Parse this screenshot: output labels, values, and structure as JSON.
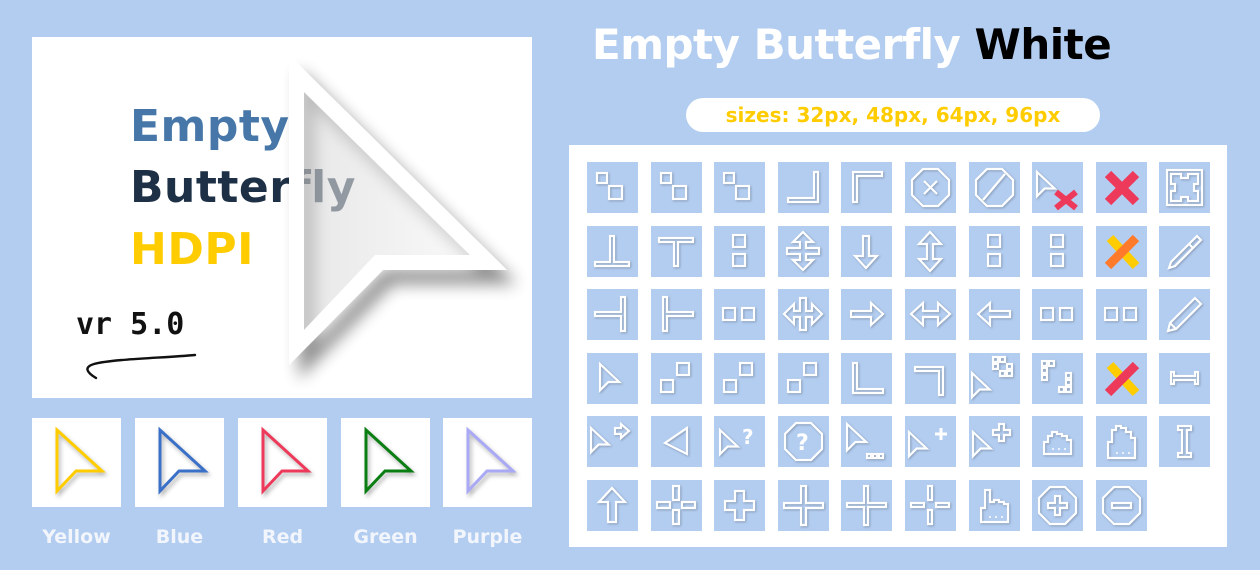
{
  "preview": {
    "title_line1": "Empty",
    "title_line2": "Butterfly",
    "title_line3": "HDPI",
    "version": "vr 5.0",
    "colors": {
      "line1": "#4677A8",
      "line2": "#1E3045",
      "line3": "#FFCC00"
    }
  },
  "variants": [
    {
      "label": "Yellow",
      "color": "#FFCC00"
    },
    {
      "label": "Blue",
      "color": "#3A70C8"
    },
    {
      "label": "Red",
      "color": "#EE3A5A"
    },
    {
      "label": "Green",
      "color": "#0A7E12"
    },
    {
      "label": "Purple",
      "color": "#A9A9F5"
    }
  ],
  "header": {
    "title_main": "Empty Butterfly",
    "title_accent": "White",
    "sizes_label": "sizes: 32px, 48px, 64px, 96px"
  },
  "icon_grid": {
    "rows": [
      [
        "resize-diagonal-1",
        "resize-diagonal-2",
        "resize-diagonal-3",
        "corner-bottom-right",
        "corner-top-left",
        "not-allowed-octagon-x",
        "no-drop",
        "pointer-x",
        "red-x",
        "fullscreen-frame"
      ],
      [
        "side-bottom",
        "side-top",
        "resize-vertical-boxes",
        "split-vertical",
        "arrow-down",
        "resize-vertical",
        "resize-vertical-boxes-2",
        "resize-vertical-boxes-3",
        "orange-x",
        "color-picker"
      ],
      [
        "side-right",
        "side-left",
        "resize-horizontal-boxes",
        "split-horizontal",
        "arrow-right",
        "resize-horizontal",
        "arrow-left",
        "resize-horizontal-boxes-2",
        "resize-horizontal-boxes-3",
        "pencil"
      ],
      [
        "pointer",
        "resize-diagonal-4",
        "resize-diagonal-5",
        "resize-diagonal-6",
        "corner-bottom-left",
        "corner-top-right",
        "pointer-grid",
        "dotted-selection",
        "pink-yellow-x",
        "resize-horizontal-bar"
      ],
      [
        "pointer-forward",
        "pointer-left",
        "pointer-help",
        "help-octagon",
        "pointer-busy",
        "pointer-plus",
        "pointer-move",
        "grab-hand",
        "open-hand",
        "text-beam"
      ],
      [
        "arrow-up",
        "crosshair-dashed",
        "plus-bold",
        "cross-thin",
        "cross-thin-2",
        "crosshair-dashed-2",
        "pointing-hand",
        "zoom-in-octagon",
        "zoom-out-octagon"
      ]
    ]
  }
}
